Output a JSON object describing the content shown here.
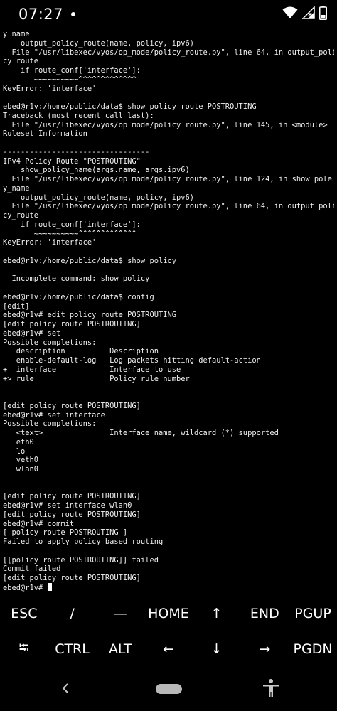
{
  "status_bar": {
    "time": "07:27",
    "icons": [
      "dot-notification-icon",
      "wifi-icon",
      "signal-icon",
      "battery-icon"
    ]
  },
  "terminal": {
    "lines": [
      "y_name",
      "    output_policy_route(name, policy, ipv6)",
      "  File \"/usr/libexec/vyos/op_mode/policy_route.py\", line 64, in output_poli",
      "cy_route",
      "    if route_conf['interface']:",
      "       ~~~~~~~~~~^^^^^^^^^^^^^",
      "KeyError: 'interface'",
      "",
      "ebed@r1v:/home/public/data$ show policy route POSTROUTING",
      "Traceback (most recent call last):",
      "  File \"/usr/libexec/vyos/op_mode/policy_route.py\", line 145, in <module>",
      "Ruleset Information",
      "",
      "---------------------------------",
      "IPv4 Policy Route \"POSTROUTING\"",
      "    show_policy_name(args.name, args.ipv6)",
      "  File \"/usr/libexec/vyos/op_mode/policy_route.py\", line 124, in show_pole",
      "y_name",
      "    output_policy_route(name, policy, ipv6)",
      "  File \"/usr/libexec/vyos/op_mode/policy_route.py\", line 64, in output_poli",
      "cy_route",
      "    if route_conf['interface']:",
      "       ~~~~~~~~~~^^^^^^^^^^^^^",
      "KeyError: 'interface'",
      "",
      "ebed@r1v:/home/public/data$ show policy",
      "",
      "  Incomplete command: show policy",
      "",
      "ebed@r1v:/home/public/data$ config",
      "[edit]",
      "ebed@r1v# edit policy route POSTROUTING",
      "[edit policy route POSTROUTING]",
      "ebed@r1v# set",
      "Possible completions:",
      "   description          Description",
      "   enable-default-log   Log packets hitting default-action",
      "+  interface            Interface to use",
      "+> rule                 Policy rule number",
      "",
      "",
      "[edit policy route POSTROUTING]",
      "ebed@r1v# set interface",
      "Possible completions:",
      "   <text>               Interface name, wildcard (*) supported",
      "   eth0",
      "   lo",
      "   veth0",
      "   wlan0",
      "",
      "",
      "[edit policy route POSTROUTING]",
      "ebed@r1v# set interface wlan0",
      "[edit policy route POSTROUTING]",
      "ebed@r1v# commit",
      "[ policy route POSTROUTING ]",
      "Failed to apply policy based routing",
      "",
      "[[policy route POSTROUTING]] failed",
      "Commit failed",
      "[edit policy route POSTROUTING]",
      "ebed@r1v# "
    ]
  },
  "extra_keys": {
    "row1": [
      {
        "name": "key-esc",
        "label": "ESC"
      },
      {
        "name": "key-slash",
        "label": "/"
      },
      {
        "name": "key-dash",
        "label": "—"
      },
      {
        "name": "key-home",
        "label": "HOME"
      },
      {
        "name": "key-up",
        "label": "↑"
      },
      {
        "name": "key-end",
        "label": "END"
      },
      {
        "name": "key-pgup",
        "label": "PGUP"
      }
    ],
    "row2": [
      {
        "name": "key-tab",
        "label": "⭾"
      },
      {
        "name": "key-ctrl",
        "label": "CTRL"
      },
      {
        "name": "key-alt",
        "label": "ALT"
      },
      {
        "name": "key-left",
        "label": "←"
      },
      {
        "name": "key-down",
        "label": "↓"
      },
      {
        "name": "key-right",
        "label": "→"
      },
      {
        "name": "key-pgdn",
        "label": "PGDN"
      }
    ]
  },
  "colors": {
    "background": "#000000",
    "text": "#f0f0f0",
    "nav_pill": "#b8b8b8"
  }
}
